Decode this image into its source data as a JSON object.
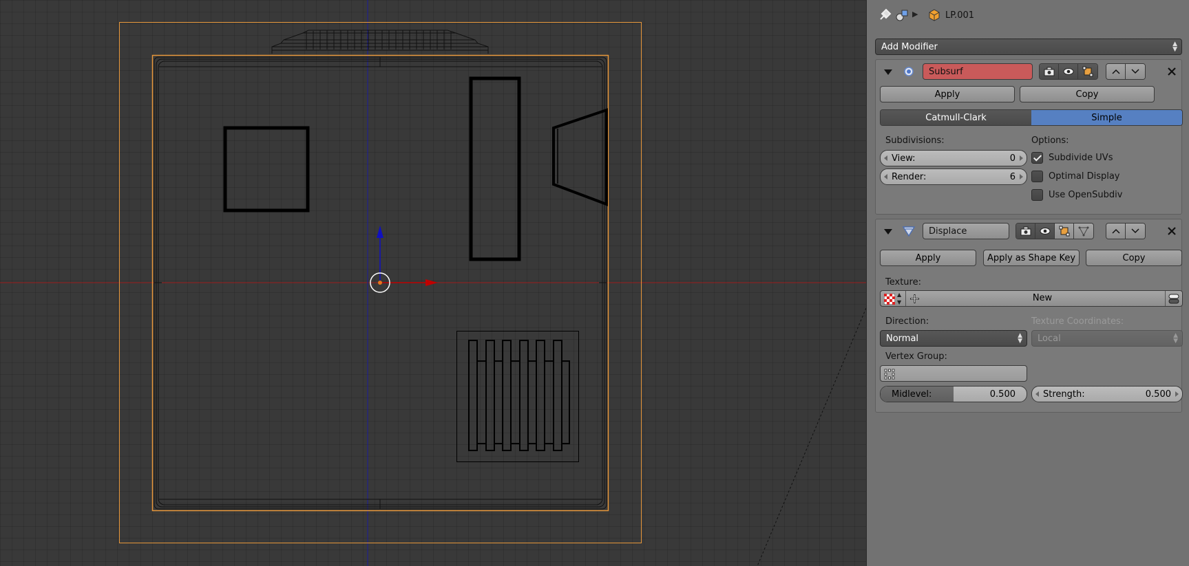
{
  "header": {
    "object_name": "LP.001",
    "icons": [
      "pin-icon",
      "modifier-wrench-icon",
      "mesh-object-icon"
    ]
  },
  "add_modifier": {
    "label": "Add Modifier"
  },
  "subsurf": {
    "name": "Subsurf",
    "apply_label": "Apply",
    "copy_label": "Copy",
    "algorithm_options": [
      "Catmull-Clark",
      "Simple"
    ],
    "selected_algorithm": "Simple",
    "subdivisions_label": "Subdivisions:",
    "view_label": "View:",
    "view_value": "0",
    "render_label": "Render:",
    "render_value": "6",
    "options_label": "Options:",
    "options": [
      {
        "label": "Subdivide UVs",
        "checked": true
      },
      {
        "label": "Optimal Display",
        "checked": false
      },
      {
        "label": "Use OpenSubdiv",
        "checked": false
      }
    ]
  },
  "displace": {
    "name": "Displace",
    "apply_label": "Apply",
    "apply_shape_key_label": "Apply as Shape Key",
    "copy_label": "Copy",
    "texture_label": "Texture:",
    "texture_new_label": "New",
    "direction_label": "Direction:",
    "direction_value": "Normal",
    "texture_coords_label": "Texture Coordinates:",
    "texture_coords_value": "Local",
    "vertex_group_label": "Vertex Group:",
    "vertex_group_value": "",
    "midlevel_label": "Midlevel:",
    "midlevel_value": "0.500",
    "strength_label": "Strength:",
    "strength_value": "0.500"
  },
  "colors": {
    "viewport_bg": "#393939",
    "panel_bg": "#727272",
    "selection_outline": "#e8973a",
    "subsurf_name_bg": "#c95a5a",
    "active_segment": "#5680c2",
    "x_axis": "#c00000",
    "y_axis": "#1010c0"
  }
}
